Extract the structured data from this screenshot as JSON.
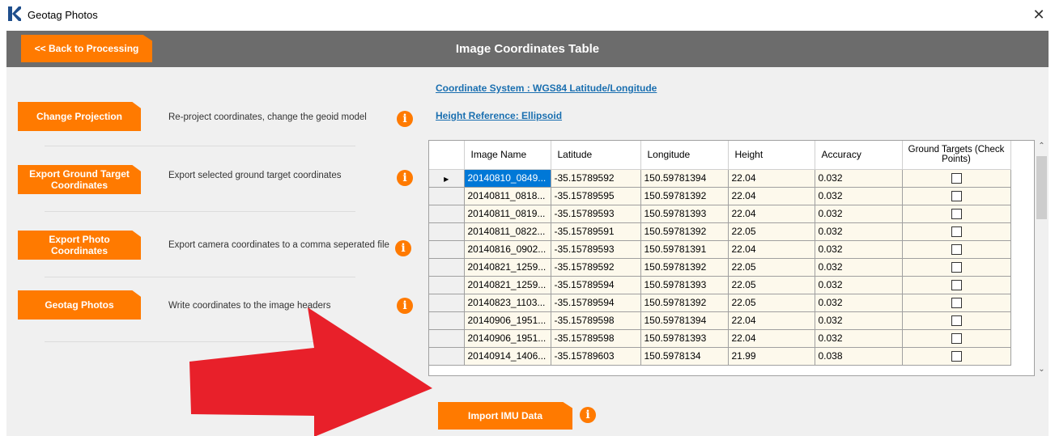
{
  "window": {
    "title": "Geotag Photos",
    "close_glyph": "✕"
  },
  "header": {
    "back_label": "<< Back to Processing",
    "title": "Image Coordinates Table"
  },
  "actions": [
    {
      "label": "Change Projection",
      "desc": "Re-project coordinates, change the geoid model"
    },
    {
      "label": "Export Ground Target Coordinates",
      "desc": "Export selected ground target coordinates"
    },
    {
      "label": "Export Photo Coordinates",
      "desc": "Export camera coordinates to a comma seperated file"
    },
    {
      "label": "Geotag Photos",
      "desc": "Write coordinates to the image headers"
    }
  ],
  "info": {
    "coordinate_system": "Coordinate System : WGS84 Latitude/Longitude",
    "height_reference": "Height Reference: Ellipsoid"
  },
  "table": {
    "columns": [
      "Image Name",
      "Latitude",
      "Longitude",
      "Height",
      "Accuracy",
      "Ground Targets (Check Points)"
    ],
    "rows": [
      [
        "20140810_0849...",
        "-35.15789592",
        "150.59781394",
        "22.04",
        "0.032",
        false
      ],
      [
        "20140811_0818...",
        "-35.15789595",
        "150.59781392",
        "22.04",
        "0.032",
        false
      ],
      [
        "20140811_0819...",
        "-35.15789593",
        "150.59781393",
        "22.04",
        "0.032",
        false
      ],
      [
        "20140811_0822...",
        "-35.15789591",
        "150.59781392",
        "22.05",
        "0.032",
        false
      ],
      [
        "20140816_0902...",
        "-35.15789593",
        "150.59781391",
        "22.04",
        "0.032",
        false
      ],
      [
        "20140821_1259...",
        "-35.15789592",
        "150.59781392",
        "22.05",
        "0.032",
        false
      ],
      [
        "20140821_1259...",
        "-35.15789594",
        "150.59781393",
        "22.05",
        "0.032",
        false
      ],
      [
        "20140823_1103...",
        "-35.15789594",
        "150.59781392",
        "22.05",
        "0.032",
        false
      ],
      [
        "20140906_1951...",
        "-35.15789598",
        "150.59781394",
        "22.04",
        "0.032",
        false
      ],
      [
        "20140906_1951...",
        "-35.15789598",
        "150.59781393",
        "22.04",
        "0.032",
        false
      ],
      [
        "20140914_1406...",
        "-35.15789603",
        "150.5978134",
        "21.99",
        "0.038",
        false
      ]
    ]
  },
  "import_label": "Import IMU Data",
  "colors": {
    "accent": "#ff7a00",
    "header_bg": "#6c6c6c",
    "link": "#1a6fb0",
    "selection": "#0078d7",
    "arrow": "#e8202a"
  },
  "icons": {
    "info": "info-icon",
    "logo": "k-logo-icon"
  }
}
